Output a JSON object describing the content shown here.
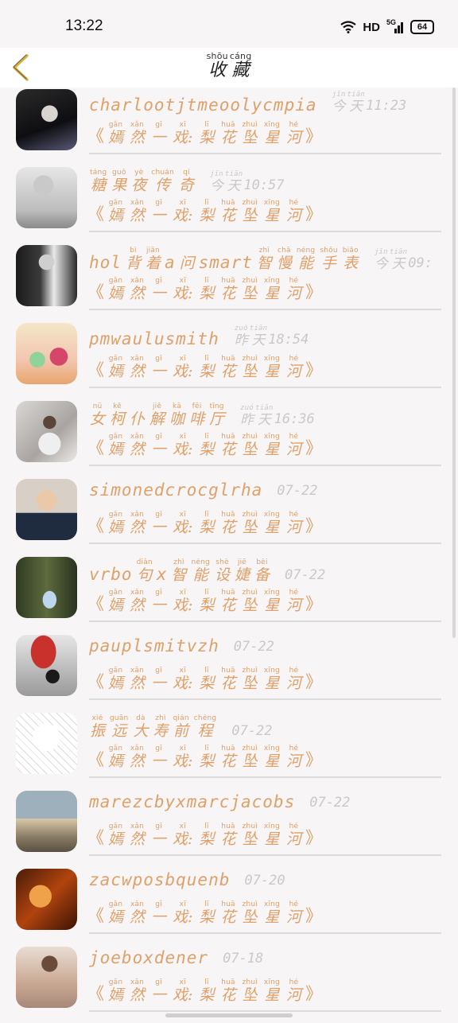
{
  "status": {
    "time": "13:22",
    "hd": "HD",
    "net": "5G",
    "battery": "64"
  },
  "header": {
    "back_icon": "chevron-left-icon",
    "title": [
      {
        "py": "shōu",
        "hz": "收"
      },
      {
        "py": "cáng",
        "hz": "藏"
      }
    ]
  },
  "accent_color": "#e0a06a",
  "subtitle": [
    {
      "py": "",
      "hz": "《"
    },
    {
      "py": "gǎn",
      "hz": "嫣"
    },
    {
      "py": "xǎn",
      "hz": "然"
    },
    {
      "py": "gī",
      "hz": "一"
    },
    {
      "py": "xī",
      "hz": "戏:"
    },
    {
      "py": "lī",
      "hz": "梨"
    },
    {
      "py": "huā",
      "hz": "花"
    },
    {
      "py": "zhuì",
      "hz": "坠"
    },
    {
      "py": "xīng",
      "hz": "星"
    },
    {
      "py": "hé",
      "hz": "河"
    },
    {
      "py": "",
      "hz": "》"
    }
  ],
  "items": [
    {
      "avatar": "avatar-dark-portrait",
      "name": [
        {
          "t": "charlootjtmeoolycmpia"
        }
      ],
      "time": [
        {
          "py": "jīn",
          "hz": "今"
        },
        {
          "py": "tiān",
          "hz": "天"
        },
        {
          "t": "11:23"
        }
      ]
    },
    {
      "avatar": "avatar-sad-girl",
      "name": [
        {
          "py": "táng",
          "hz": "糖"
        },
        {
          "py": "guǒ",
          "hz": "果"
        },
        {
          "py": "yè",
          "hz": "夜"
        },
        {
          "py": "chuán",
          "hz": "传"
        },
        {
          "py": "qí",
          "hz": "奇"
        }
      ],
      "time": [
        {
          "py": "jīn",
          "hz": "今"
        },
        {
          "py": "tiān",
          "hz": "天"
        },
        {
          "t": "10:57"
        }
      ]
    },
    {
      "avatar": "avatar-man-bw",
      "name": [
        {
          "t": "hol"
        },
        {
          "py": "bì",
          "hz": "背"
        },
        {
          "py": "jiān",
          "hz": "着"
        },
        {
          "t": "a"
        },
        {
          "hz": "问"
        },
        {
          "t": "smart"
        },
        {
          "py": "zhì",
          "hz": "智"
        },
        {
          "py": "chā",
          "hz": "慢"
        },
        {
          "py": "néng",
          "hz": "能"
        },
        {
          "py": "shǒu",
          "hz": "手"
        },
        {
          "py": "biǎo",
          "hz": "表"
        }
      ],
      "time": [
        {
          "py": "jīn",
          "hz": "今"
        },
        {
          "py": "tiān",
          "hz": "天"
        },
        {
          "t": "09:"
        }
      ]
    },
    {
      "avatar": "avatar-flowers",
      "name": [
        {
          "t": "pmwaulusmith"
        }
      ],
      "time": [
        {
          "py": "zuó",
          "hz": "昨"
        },
        {
          "py": "tiān",
          "hz": "天"
        },
        {
          "t": "18:54"
        }
      ]
    },
    {
      "avatar": "avatar-girl-stairs",
      "name": [
        {
          "py": "nǚ",
          "hz": "女"
        },
        {
          "py": "kě",
          "hz": "柯"
        },
        {
          "py": "",
          "hz": "仆"
        },
        {
          "py": "jiě",
          "hz": "解"
        },
        {
          "py": "kā",
          "hz": "咖"
        },
        {
          "py": "fēi",
          "hz": "啡"
        },
        {
          "py": "tīng",
          "hz": "厅"
        }
      ],
      "time": [
        {
          "py": "zuó",
          "hz": "昨"
        },
        {
          "py": "tiān",
          "hz": "天"
        },
        {
          "t": "16:36"
        }
      ]
    },
    {
      "avatar": "avatar-covering-face",
      "name": [
        {
          "t": "simonedcrocglrha"
        }
      ],
      "time": [
        {
          "t": "07-22"
        }
      ]
    },
    {
      "avatar": "avatar-forest-dress",
      "name": [
        {
          "t": "vrbo"
        },
        {
          "py": "diǎn",
          "hz": "句"
        },
        {
          "t": "x"
        },
        {
          "py": "zhì",
          "hz": "智"
        },
        {
          "py": "néng",
          "hz": "能"
        },
        {
          "py": "shè",
          "hz": "设"
        },
        {
          "py": "jiē",
          "hz": "婕"
        },
        {
          "py": "bèi",
          "hz": "备"
        }
      ],
      "time": [
        {
          "t": "07-22"
        }
      ]
    },
    {
      "avatar": "avatar-red-umbrella",
      "name": [
        {
          "t": "pauplsmitvzh"
        }
      ],
      "time": [
        {
          "t": "07-22"
        }
      ]
    },
    {
      "avatar": "avatar-tiger-sketch",
      "name": [
        {
          "py": "xié",
          "hz": "振"
        },
        {
          "py": "guān",
          "hz": "远"
        },
        {
          "py": "dà",
          "hz": "大"
        },
        {
          "py": "zhì",
          "hz": "寿"
        },
        {
          "py": "qián",
          "hz": "前"
        },
        {
          "py": "chéng",
          "hz": "程"
        }
      ],
      "time": [
        {
          "t": "07-22"
        }
      ]
    },
    {
      "avatar": "avatar-birds-lake",
      "name": [
        {
          "t": "marezcbyxmarcjacobs"
        }
      ],
      "time": [
        {
          "t": "07-22"
        }
      ]
    },
    {
      "avatar": "avatar-warrior",
      "name": [
        {
          "t": "zacwposbquenb"
        }
      ],
      "time": [
        {
          "t": "07-20"
        }
      ]
    },
    {
      "avatar": "avatar-lace-girl",
      "name": [
        {
          "t": "joeboxdener"
        }
      ],
      "time": [
        {
          "t": "07-18"
        }
      ]
    }
  ]
}
